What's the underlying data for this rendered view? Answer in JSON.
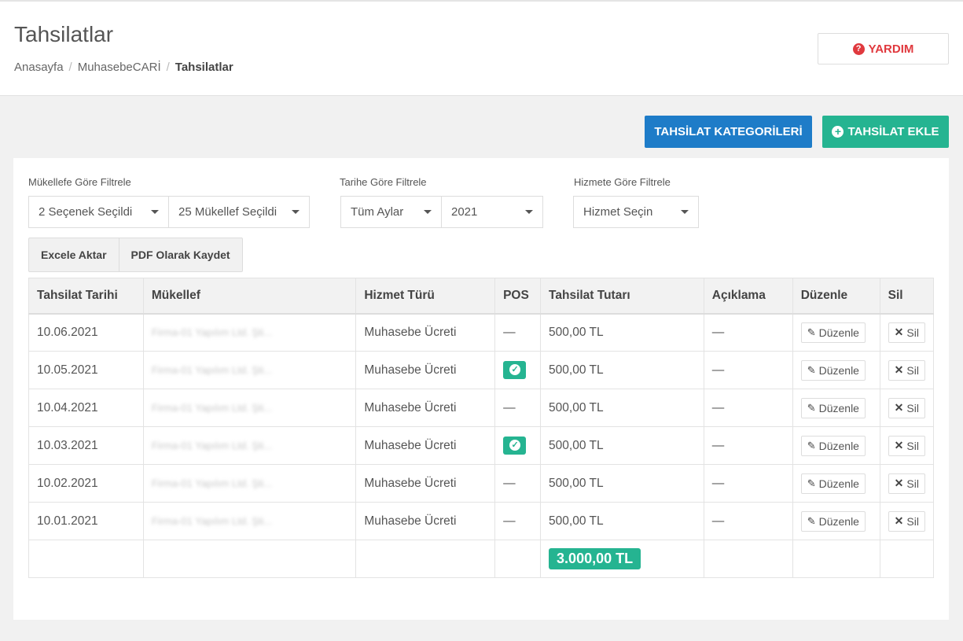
{
  "header": {
    "title": "Tahsilatlar",
    "breadcrumb": [
      "Anasayfa",
      "MuhasebeCARİ",
      "Tahsilatlar"
    ],
    "help_label": "YARDIM"
  },
  "actions": {
    "categories_label": "TAHSİLAT KATEGORİLERİ",
    "add_label": "TAHSİLAT EKLE"
  },
  "filters": {
    "taxpayer_label": "Mükellefe Göre Filtrele",
    "taxpayer_select1": "2 Seçenek Seçildi",
    "taxpayer_select2": "25 Mükellef Seçildi",
    "date_label": "Tarihe Göre Filtrele",
    "month_select": "Tüm Aylar",
    "year_select": "2021",
    "service_label": "Hizmete Göre Filtrele",
    "service_select": "Hizmet Seçin"
  },
  "export": {
    "excel_label": "Excele Aktar",
    "pdf_label": "PDF Olarak Kaydet"
  },
  "table": {
    "headers": [
      "Tahsilat Tarihi",
      "Mükellef",
      "Hizmet Türü",
      "POS",
      "Tahsilat Tutarı",
      "Açıklama",
      "Düzenle",
      "Sil"
    ],
    "edit_label": "Düzenle",
    "delete_label": "Sil",
    "rows": [
      {
        "date": "10.06.2021",
        "taxpayer": "Firma-01 Yapılım Ltd. Şti...",
        "service": "Muhasebe Ücreti",
        "pos": false,
        "pos_text": "—",
        "amount": "500,00 TL",
        "note": "—"
      },
      {
        "date": "10.05.2021",
        "taxpayer": "Firma-01 Yapılım Ltd. Şti...",
        "service": "Muhasebe Ücreti",
        "pos": true,
        "pos_text": "",
        "amount": "500,00 TL",
        "note": "—"
      },
      {
        "date": "10.04.2021",
        "taxpayer": "Firma-01 Yapılım Ltd. Şti...",
        "service": "Muhasebe Ücreti",
        "pos": false,
        "pos_text": "—",
        "amount": "500,00 TL",
        "note": "—"
      },
      {
        "date": "10.03.2021",
        "taxpayer": "Firma-01 Yapılım Ltd. Şti...",
        "service": "Muhasebe Ücreti",
        "pos": true,
        "pos_text": "",
        "amount": "500,00 TL",
        "note": "—"
      },
      {
        "date": "10.02.2021",
        "taxpayer": "Firma-01 Yapılım Ltd. Şti...",
        "service": "Muhasebe Ücreti",
        "pos": false,
        "pos_text": "—",
        "amount": "500,00 TL",
        "note": "—"
      },
      {
        "date": "10.01.2021",
        "taxpayer": "Firma-01 Yapılım Ltd. Şti...",
        "service": "Muhasebe Ücreti",
        "pos": false,
        "pos_text": "—",
        "amount": "500,00 TL",
        "note": "—"
      }
    ],
    "total": "3.000,00 TL"
  },
  "colors": {
    "accent_blue": "#1e7cc8",
    "accent_green": "#25b491",
    "danger_red": "#e0393e"
  }
}
